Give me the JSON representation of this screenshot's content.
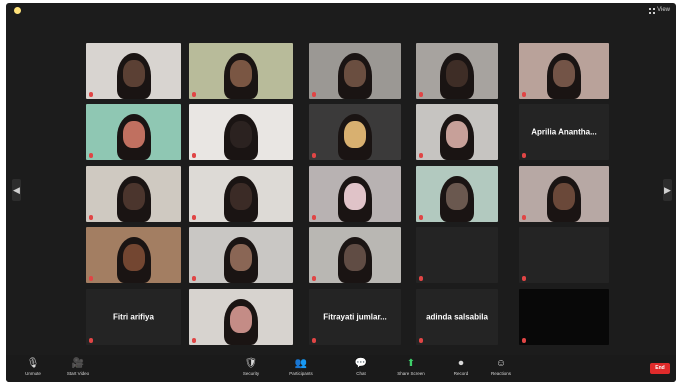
{
  "window": {
    "title": ""
  },
  "topbar": {
    "view_label": "View"
  },
  "tiles": [
    {
      "name": "",
      "bg": "#d8d4d0",
      "skin": "#5b4034",
      "style": "video"
    },
    {
      "name": "",
      "bg": "#b8bb9a",
      "skin": "#7a5643",
      "style": "video"
    },
    {
      "name": "",
      "bg": "#9b9894",
      "skin": "#6a4e40",
      "style": "video"
    },
    {
      "name": "",
      "bg": "#a7a39f",
      "skin": "#3e2d26",
      "style": "video"
    },
    {
      "name": "",
      "bg": "#b9a29a",
      "skin": "#735447",
      "style": "video"
    },
    {
      "name": "",
      "bg": "#8fc7b3",
      "skin": "#c07060",
      "style": "video"
    },
    {
      "name": "",
      "bg": "#e9e6e3",
      "skin": "#2b2220",
      "style": "video"
    },
    {
      "name": "",
      "bg": "#3b3a3a",
      "skin": "#d8b070",
      "style": "video"
    },
    {
      "name": "",
      "bg": "#c6c4c1",
      "skin": "#c7a099",
      "style": "video"
    },
    {
      "name": "Aprilia Anantha...",
      "bg": "#242424",
      "skin": "",
      "style": "name"
    },
    {
      "name": "",
      "bg": "#cfc9c1",
      "skin": "#4b352d",
      "style": "video"
    },
    {
      "name": "",
      "bg": "#dddad6",
      "skin": "#3b2b26",
      "style": "video"
    },
    {
      "name": "",
      "bg": "#b8b2b2",
      "skin": "#e0c3c8",
      "style": "video"
    },
    {
      "name": "",
      "bg": "#b2c9bf",
      "skin": "#6a584f",
      "style": "video"
    },
    {
      "name": "",
      "bg": "#b7a8a4",
      "skin": "#6a4839",
      "style": "video"
    },
    {
      "name": "",
      "bg": "#a37e62",
      "skin": "#734631",
      "style": "video"
    },
    {
      "name": "",
      "bg": "#c9c7c4",
      "skin": "#8a6655",
      "style": "video"
    },
    {
      "name": "",
      "bg": "#b9b7b3",
      "skin": "#604c44",
      "style": "video"
    },
    {
      "name": "",
      "bg": "#242424",
      "skin": "",
      "style": "name"
    },
    {
      "name": "",
      "bg": "#242424",
      "skin": "",
      "style": "name"
    },
    {
      "name": "Fitri arifiya",
      "bg": "#242424",
      "skin": "",
      "style": "name"
    },
    {
      "name": "",
      "bg": "#d7d3cf",
      "skin": "#c48c86",
      "style": "video"
    },
    {
      "name": "Fitrayati jumlar...",
      "bg": "#242424",
      "skin": "",
      "style": "name"
    },
    {
      "name": "adinda salsabila",
      "bg": "#242424",
      "skin": "",
      "style": "name"
    },
    {
      "name": "",
      "bg": "#080808",
      "skin": "",
      "style": "dark"
    }
  ],
  "toolbar": {
    "items": [
      {
        "id": "unmute",
        "icon": "microphone-icon",
        "glyph": "🎙",
        "label": "Unmute"
      },
      {
        "id": "video",
        "icon": "video-camera-icon",
        "glyph": "🎥",
        "label": "Start Video"
      },
      {
        "id": "security",
        "icon": "shield-icon",
        "glyph": "🛡",
        "label": "Security"
      },
      {
        "id": "participants",
        "icon": "people-icon",
        "glyph": "👥",
        "label": "Participants"
      },
      {
        "id": "chat",
        "icon": "chat-icon",
        "glyph": "💬",
        "label": "Chat"
      },
      {
        "id": "share",
        "icon": "share-screen-icon",
        "glyph": "⬆",
        "label": "Share Screen"
      },
      {
        "id": "record",
        "icon": "record-icon",
        "glyph": "⏺",
        "label": "Record"
      },
      {
        "id": "reactions",
        "icon": "smile-icon",
        "glyph": "☺",
        "label": "Reactions"
      }
    ],
    "end_label": "End"
  },
  "colors": {
    "window_bg": "#1c1c1c",
    "share_green": "#3ecf6a",
    "end_red": "#e02b2b"
  }
}
